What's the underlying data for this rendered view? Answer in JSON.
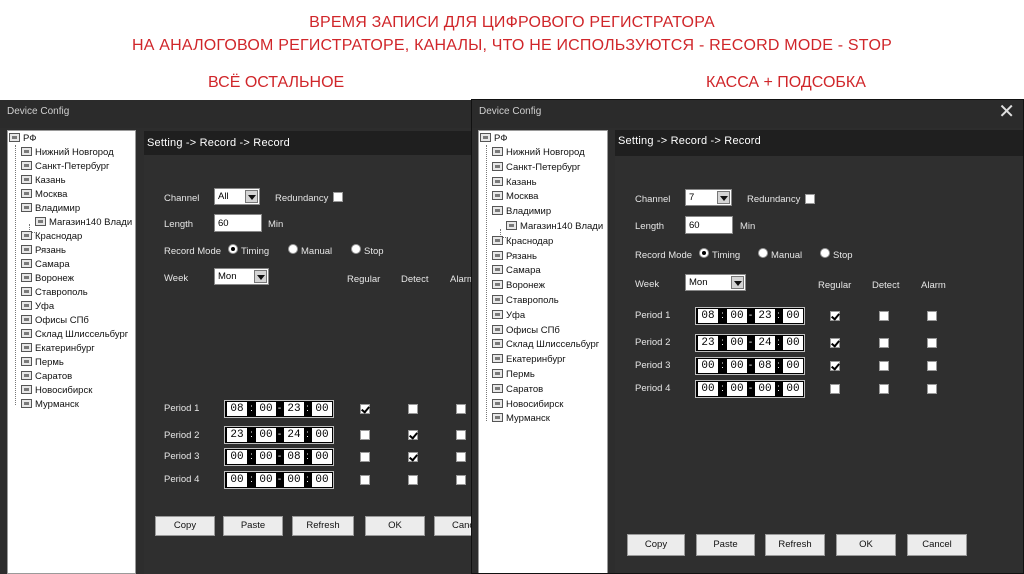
{
  "slide": {
    "title_line1": "ВРЕМЯ ЗАПИСИ ДЛЯ ЦИФРОВОГО РЕГИСТРАТОРА",
    "title_line2": "НА АНАЛОГОВОМ РЕГИСТРАТОРЕ, КАНАЛЫ, ЧТО НЕ ИСПОЛЬЗУЮТСЯ - RECORD MODE - STOP",
    "label_left": "ВСЁ ОСТАЛЬНОЕ",
    "label_right": "КАССА + ПОДСОБКА"
  },
  "left_window": {
    "title": "Device Config",
    "tree": {
      "root": "РФ",
      "items": [
        "Нижний Новгород",
        "Санкт-Петербург",
        "Казань",
        "Москва",
        "Владимир",
        "Магазин140 Влади",
        "Краснодар",
        "Рязань",
        "Самара",
        "Воронеж",
        "Ставрополь",
        "Уфа",
        "Офисы СПб",
        "Склад Шлиссельбург",
        "Екатеринбург",
        "Пермь",
        "Саратов",
        "Новосибирск",
        "Мурманск"
      ]
    },
    "breadcrumb": "Setting -> Record -> Record",
    "channel_label": "Channel",
    "channel_value": "All",
    "redundancy_label": "Redundancy",
    "length_label": "Length",
    "length_value": "60",
    "length_unit": "Min",
    "record_mode_label": "Record Mode",
    "mode_timing": "Timing",
    "mode_manual": "Manual",
    "mode_stop": "Stop",
    "week_label": "Week",
    "week_value": "Mon",
    "col_regular": "Regular",
    "col_detect": "Detect",
    "col_alarm": "Alarm",
    "periods": [
      {
        "label": "Period 1",
        "h1": "08",
        "m1": "00",
        "h2": "23",
        "m2": "00"
      },
      {
        "label": "Period 2",
        "h1": "23",
        "m1": "00",
        "h2": "24",
        "m2": "00"
      },
      {
        "label": "Period 3",
        "h1": "00",
        "m1": "00",
        "h2": "08",
        "m2": "00"
      },
      {
        "label": "Period 4",
        "h1": "00",
        "m1": "00",
        "h2": "00",
        "m2": "00"
      }
    ],
    "buttons": {
      "copy": "Copy",
      "paste": "Paste",
      "refresh": "Refresh",
      "ok": "OK",
      "cancel": "Canc"
    }
  },
  "right_window": {
    "title": "Device Config",
    "tree": {
      "root": "РФ",
      "items": [
        "Нижний Новгород",
        "Санкт-Петербург",
        "Казань",
        "Москва",
        "Владимир",
        "Магазин140 Влади",
        "Краснодар",
        "Рязань",
        "Самара",
        "Воронеж",
        "Ставрополь",
        "Уфа",
        "Офисы СПб",
        "Склад Шлиссельбург",
        "Екатеринбург",
        "Пермь",
        "Саратов",
        "Новосибирск",
        "Мурманск"
      ]
    },
    "breadcrumb": "Setting -> Record -> Record",
    "channel_label": "Channel",
    "channel_value": "7",
    "redundancy_label": "Redundancy",
    "length_label": "Length",
    "length_value": "60",
    "length_unit": "Min",
    "record_mode_label": "Record Mode",
    "mode_timing": "Timing",
    "mode_manual": "Manual",
    "mode_stop": "Stop",
    "week_label": "Week",
    "week_value": "Mon",
    "col_regular": "Regular",
    "col_detect": "Detect",
    "col_alarm": "Alarm",
    "periods": [
      {
        "label": "Period 1",
        "h1": "08",
        "m1": "00",
        "h2": "23",
        "m2": "00"
      },
      {
        "label": "Period 2",
        "h1": "23",
        "m1": "00",
        "h2": "24",
        "m2": "00"
      },
      {
        "label": "Period 3",
        "h1": "00",
        "m1": "00",
        "h2": "08",
        "m2": "00"
      },
      {
        "label": "Period 4",
        "h1": "00",
        "m1": "00",
        "h2": "00",
        "m2": "00"
      }
    ],
    "buttons": {
      "copy": "Copy",
      "paste": "Paste",
      "refresh": "Refresh",
      "ok": "OK",
      "cancel": "Cancel"
    }
  }
}
